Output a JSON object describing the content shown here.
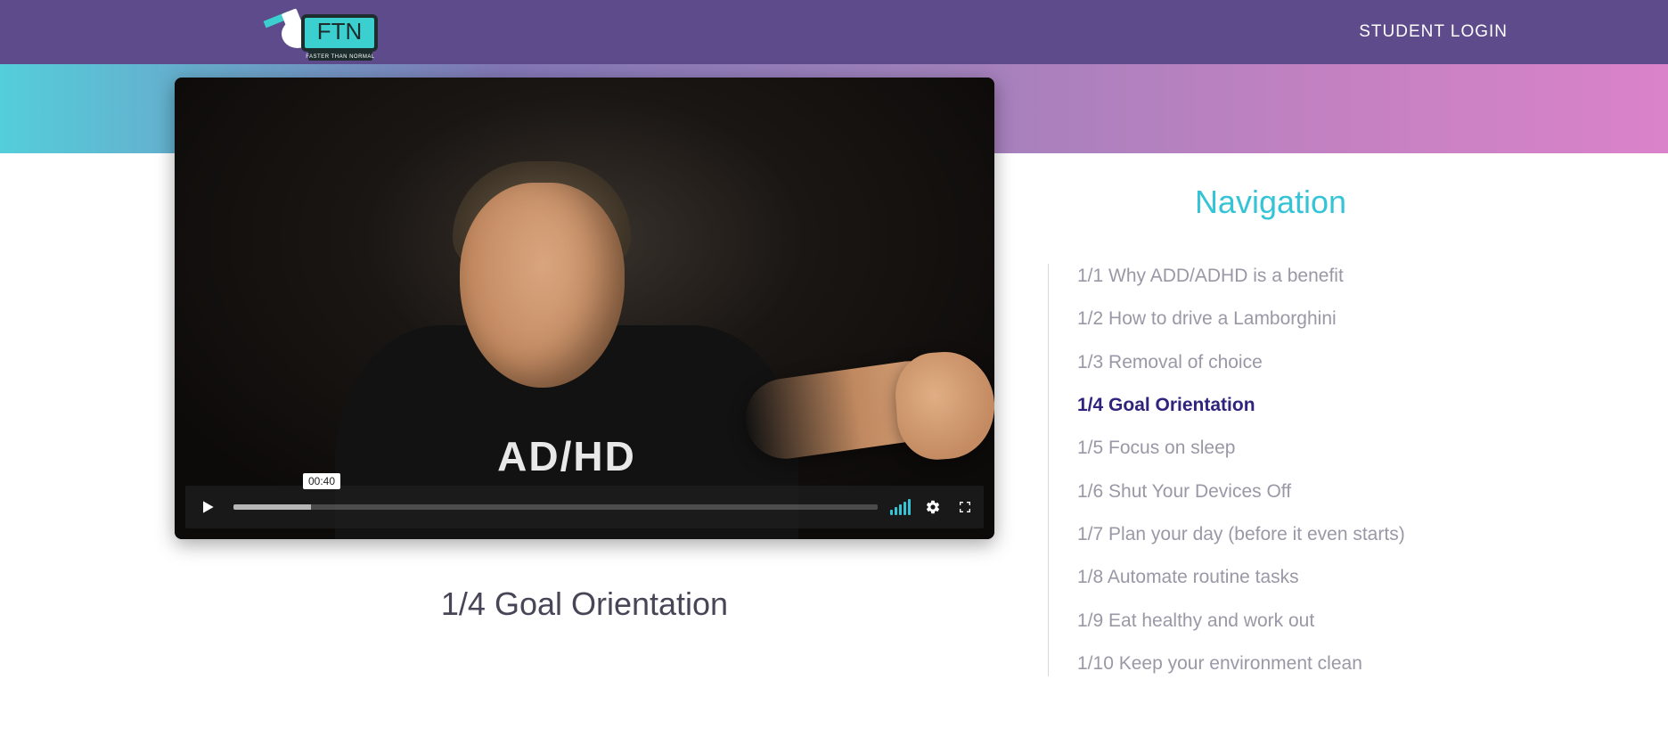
{
  "header": {
    "logo": {
      "abbr": "FTN",
      "tagline": "FASTER THAN NORMAL"
    },
    "student_login": "STUDENT LOGIN"
  },
  "video": {
    "tooltip_time": "00:40",
    "shirt_text": "AD/HD"
  },
  "lesson": {
    "title": "1/4 Goal Orientation"
  },
  "sidebar": {
    "title": "Navigation",
    "items": [
      {
        "label": "1/1 Why ADD/ADHD is a benefit",
        "active": false
      },
      {
        "label": "1/2 How to drive a Lamborghini",
        "active": false
      },
      {
        "label": "1/3 Removal of choice",
        "active": false
      },
      {
        "label": "1/4 Goal Orientation",
        "active": true
      },
      {
        "label": "1/5 Focus on sleep",
        "active": false
      },
      {
        "label": "1/6 Shut Your Devices Off",
        "active": false
      },
      {
        "label": "1/7 Plan your day (before it even starts)",
        "active": false
      },
      {
        "label": "1/8 Automate routine tasks",
        "active": false
      },
      {
        "label": "1/9 Eat healthy and work out",
        "active": false
      },
      {
        "label": "1/10 Keep your environment clean",
        "active": false
      }
    ]
  }
}
